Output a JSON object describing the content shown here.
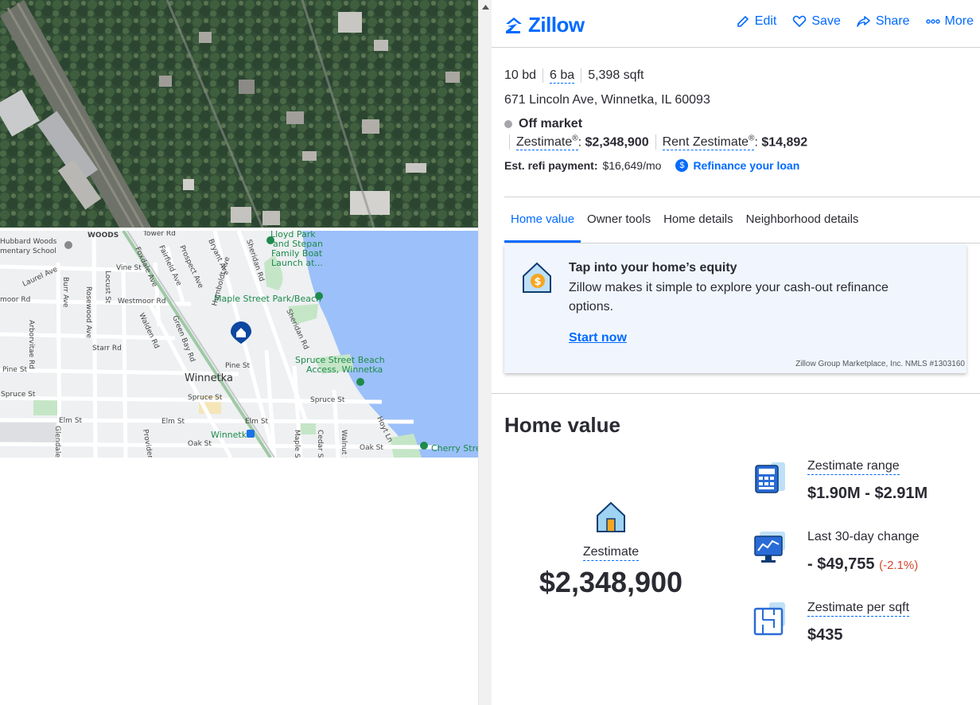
{
  "map": {
    "labels": {
      "woods": "WOODS",
      "hubbard_school_1": "Hubbard Woods",
      "hubbard_school_2": "mentary School",
      "lloyd_park_1": "Lloyd Park",
      "lloyd_park_2": "and Stepan",
      "lloyd_park_3": "Family Boat",
      "lloyd_park_4": "Launch at...",
      "maple_park": "Maple Street Park/Beach",
      "spruce_beach_1": "Spruce Street Beach",
      "spruce_beach_2": "Access, Winnetka",
      "winnetka": "Winnetka",
      "winnetka_station": "Winnetka",
      "cherry_street": "Cherry Stree",
      "sheridan_rd_1": "Sheridan Rd",
      "sheridan_rd_2": "Sheridan Rd",
      "green_bay_rd": "Green Bay Rd",
      "elm_st_1": "Elm St",
      "elm_st_2": "Elm St",
      "elm_st_3": "Elm St",
      "spruce_st_1": "Spruce St",
      "spruce_st_2": "Spruce St",
      "spruce_st_3": "Spruce St",
      "pine_st_1": "Pine St",
      "pine_st_2": "Pine St",
      "oak_st_1": "Oak St",
      "oak_st_2": "Oak St",
      "vine_st": "Vine St",
      "westmoor_rd_1": "Westmoor Rd",
      "westmoor_rd_2": "moor Rd",
      "laurel_ave": "Laurel Ave",
      "starr_rd": "Starr Rd",
      "humboldt_ave": "Humboldt Ave",
      "hoyt_ln": "Hoyt Ln",
      "tower_rd": "Tower Rd",
      "foxdale_ave": "Foxdale Ave",
      "fairfield_ave": "Fairfield Ave",
      "prospect_ave": "Prospect Ave",
      "bryant_ave": "Bryant Ave",
      "locust_st": "Locust St",
      "rosewood_ave": "Rosewood Ave",
      "walden_rd": "Walden Rd",
      "maple_st": "Maple St",
      "cedar_st": "Cedar St",
      "walnut_st": "Walnut St",
      "burr_ave": "Burr Ave",
      "glendale_ave": "Glendale Ave",
      "arbor_vitae_rd": "Arborvitae Rd",
      "provident_ave": "Provident Ave"
    }
  },
  "header": {
    "logo_text": "Zillow",
    "edit_label": "Edit",
    "save_label": "Save",
    "share_label": "Share",
    "more_label": "More"
  },
  "summary": {
    "beds": "10 bd",
    "baths": "6 ba",
    "sqft": "5,398 sqft",
    "address": "671 Lincoln Ave, Winnetka, IL 60093",
    "status": "Off market",
    "zestimate_label": "Zestimate",
    "zestimate_value": "$2,348,900",
    "rent_zestimate_label": "Rent Zestimate",
    "rent_zestimate_value": "$14,892",
    "refi_label": "Est. refi payment:",
    "refi_value": "$16,649/mo",
    "refi_link": "Refinance your loan"
  },
  "tabs": [
    {
      "label": "Home value"
    },
    {
      "label": "Owner tools"
    },
    {
      "label": "Home details"
    },
    {
      "label": "Neighborhood details"
    }
  ],
  "equity_card": {
    "title": "Tap into your home’s equity",
    "body": "Zillow makes it simple to explore your cash-out refinance options.",
    "cta": "Start now",
    "legal": "Zillow Group Marketplace, Inc. NMLS #1303160"
  },
  "home_value": {
    "title": "Home value",
    "main_label": "Zestimate",
    "main_value": "$2,348,900",
    "stats": [
      {
        "label": "Zestimate range",
        "value": "$1.90M - $2.91M",
        "icon": "calculator-icon"
      },
      {
        "label": "Last 30-day change",
        "value": "- $49,755",
        "pct": "(-2.1%)",
        "icon": "monitor-chart-icon"
      },
      {
        "label": "Zestimate per sqft",
        "value": "$435",
        "icon": "floorplan-icon"
      }
    ]
  },
  "colors": {
    "brand": "#006aff",
    "negative": "#d5462e",
    "card_bg": "#f1f6fe",
    "water": "#9cc0f9"
  }
}
